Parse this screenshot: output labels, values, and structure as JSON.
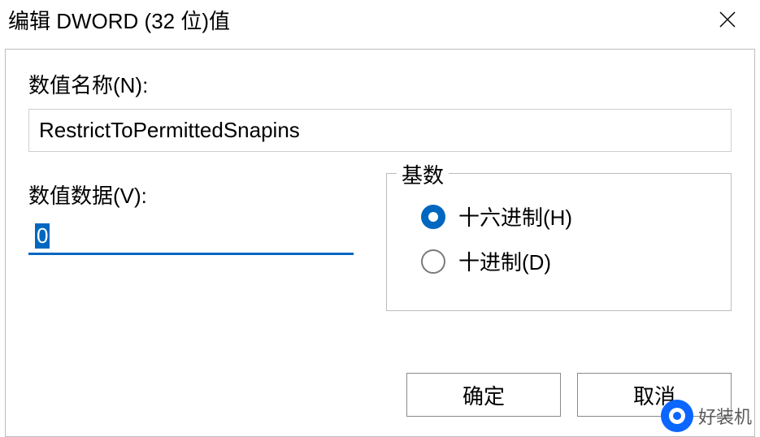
{
  "dialog": {
    "title": "编辑 DWORD (32 位)值",
    "name_label": "数值名称(N):",
    "name_value": "RestrictToPermittedSnapins",
    "value_label": "数值数据(V):",
    "value_data": "0",
    "base_group_label": "基数",
    "radio_hex_label": "十六进制(H)",
    "radio_dec_label": "十进制(D)",
    "radio_selected": "hex",
    "ok_label": "确定",
    "cancel_label": "取消"
  },
  "watermark": {
    "text": "好装机"
  }
}
